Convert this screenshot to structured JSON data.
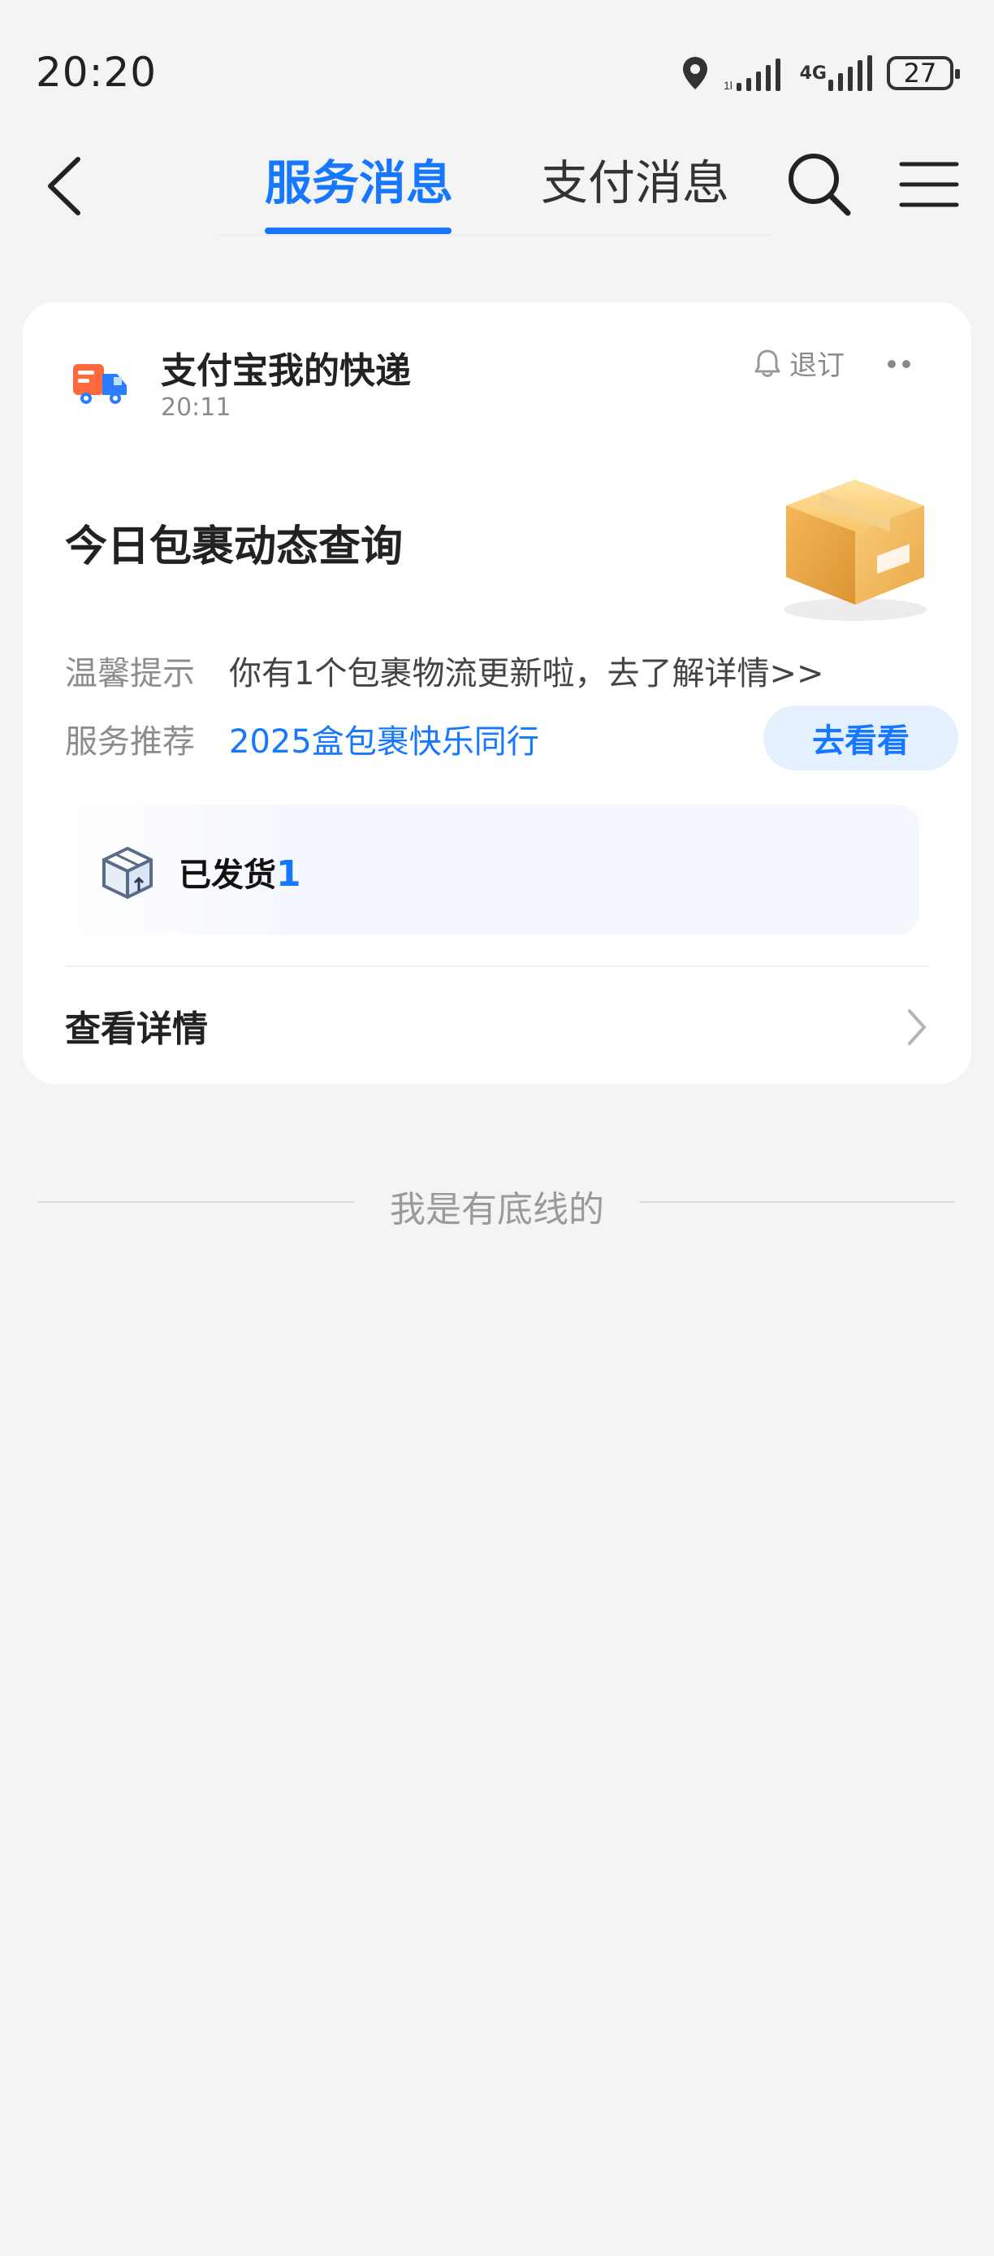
{
  "status_bar": {
    "time": "20:20",
    "network": "4G",
    "battery": "27",
    "icons": [
      "location-icon",
      "signal-icon",
      "signal-4g-icon",
      "battery-icon"
    ]
  },
  "nav": {
    "tabs": [
      {
        "label": "服务消息",
        "active": true
      },
      {
        "label": "支付消息",
        "active": false
      }
    ],
    "icons": [
      "back-icon",
      "search-icon",
      "menu-icon"
    ],
    "accent": "#1677ff"
  },
  "card": {
    "service_name": "支付宝我的快递",
    "time": "20:11",
    "unsubscribe_label": "退订",
    "headline": "今日包裹动态查询",
    "rows": [
      {
        "label": "温馨提示",
        "value": "你有1个包裹物流更新啦，去了解详情>>"
      },
      {
        "label": "服务推荐",
        "value": "2025盒包裹快乐同行"
      }
    ],
    "go_button": "去看看",
    "shipped_label": "已发货",
    "shipped_count": "1",
    "details_label": "查看详情"
  },
  "footer": {
    "text": "我是有底线的"
  }
}
